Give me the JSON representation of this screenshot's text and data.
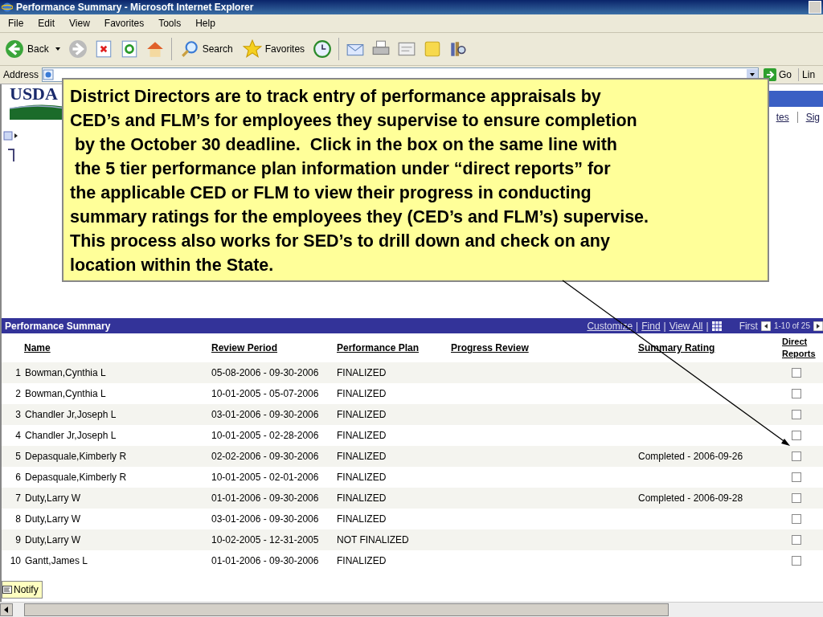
{
  "window": {
    "title": "Performance Summary - Microsoft Internet Explorer"
  },
  "menu": [
    "File",
    "Edit",
    "View",
    "Favorites",
    "Tools",
    "Help"
  ],
  "toolbar": {
    "back": "Back",
    "search": "Search",
    "favorites": "Favorites"
  },
  "address": {
    "label": "Address",
    "go": "Go",
    "links": "Lin"
  },
  "logo_text": "USDA",
  "header_links": [
    "tes",
    "Sig"
  ],
  "callout": "District Directors are to track entry of performance appraisals by\nCED’s and FLM’s for employees they supervise to ensure completion\n by the October 30 deadline.  Click in the box on the same line with\n the 5 tier performance plan information under “direct reports” for\nthe applicable CED or FLM to view their progress in conducting\nsummary ratings for the employees they (CED’s and FLM’s) supervise.\nThis process also works for SED’s to drill down and check on any\nlocation within the State.",
  "grid": {
    "title": "Performance Summary",
    "links": [
      "Customize",
      "Find",
      "View All"
    ],
    "separator": "|",
    "first": "First",
    "range": "1-10 of 25",
    "columns": [
      "Name",
      "Review Period",
      "Performance Plan",
      "Progress Review",
      "Summary Rating",
      "Direct Reports"
    ],
    "rows": [
      {
        "number": "1",
        "name": "Bowman,Cynthia L",
        "period": "05-08-2006 - 09-30-2006",
        "plan": "FINALIZED",
        "rating": "",
        "checked": false
      },
      {
        "number": "2",
        "name": "Bowman,Cynthia L",
        "period": "10-01-2005 - 05-07-2006",
        "plan": "FINALIZED",
        "rating": "",
        "checked": false
      },
      {
        "number": "3",
        "name": "Chandler Jr,Joseph L",
        "period": "03-01-2006 - 09-30-2006",
        "plan": "FINALIZED",
        "rating": "",
        "checked": false
      },
      {
        "number": "4",
        "name": "Chandler Jr,Joseph L",
        "period": "10-01-2005 - 02-28-2006",
        "plan": "FINALIZED",
        "rating": "",
        "checked": false
      },
      {
        "number": "5",
        "name": "Depasquale,Kimberly R",
        "period": "02-02-2006 - 09-30-2006",
        "plan": "FINALIZED",
        "rating": "Completed - 2006-09-26",
        "checked": false
      },
      {
        "number": "6",
        "name": "Depasquale,Kimberly R",
        "period": "10-01-2005 - 02-01-2006",
        "plan": "FINALIZED",
        "rating": "",
        "checked": false
      },
      {
        "number": "7",
        "name": "Duty,Larry W",
        "period": "01-01-2006 - 09-30-2006",
        "plan": "FINALIZED",
        "rating": "Completed - 2006-09-28",
        "checked": false
      },
      {
        "number": "8",
        "name": "Duty,Larry W",
        "period": "03-01-2006 - 09-30-2006",
        "plan": "FINALIZED",
        "rating": "",
        "checked": false
      },
      {
        "number": "9",
        "name": "Duty,Larry W",
        "period": "10-02-2005 - 12-31-2005",
        "plan": "NOT FINALIZED",
        "rating": "",
        "checked": false
      },
      {
        "number": "10",
        "name": "Gantt,James L",
        "period": "01-01-2006 - 09-30-2006",
        "plan": "FINALIZED",
        "rating": "",
        "checked": false
      }
    ]
  },
  "notify": "Notify"
}
